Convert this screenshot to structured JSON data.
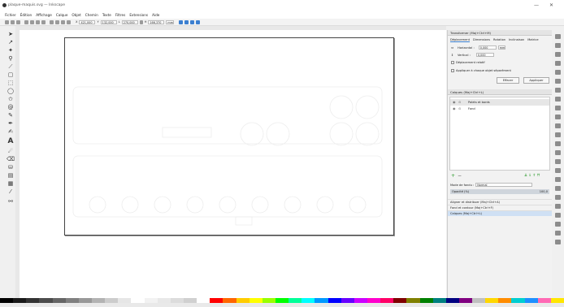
{
  "window": {
    "title": "plaque-maquis.svg — Inkscape",
    "minimize": "—",
    "close": "✕"
  },
  "menu": [
    "Fichier",
    "Édition",
    "Affichage",
    "Calque",
    "Objet",
    "Chemin",
    "Texte",
    "Filtres",
    "Extensions",
    "Aide"
  ],
  "toolbar": {
    "x_label": "X",
    "x_value": "421,000",
    "y_label": "Y",
    "y_value": "132,000",
    "w_label": "L",
    "w_value": "270,000",
    "h_label": "H",
    "h_value": "166,370",
    "unit": "mm"
  },
  "transform_panel": {
    "header": "Transformer (Maj+Ctrl+M)",
    "tabs": [
      "Déplacement",
      "Dimensions",
      "Rotation",
      "Inclinaison",
      "Matrice"
    ],
    "horizontal_label": "Horizontal :",
    "horizontal_value": "0,000",
    "vertical_label": "Vertical :",
    "vertical_value": "0,000",
    "unit": "mm",
    "relative_label": "Déplacement relatif",
    "each_label": "Appliquer à chaque objet séparément",
    "clear_button": "Effacer",
    "apply_button": "Appliquer"
  },
  "layers_panel": {
    "header": "Calques (Maj+Ctrl+L)",
    "layers": [
      {
        "name": "Palets et bords"
      },
      {
        "name": "Fond"
      }
    ],
    "blend_label": "Mode de fondu :",
    "blend_value": "Normal",
    "opacity_label": "Opacité (%)",
    "opacity_value": "100,0"
  },
  "docked": [
    "Aligner et distribuer (Maj+Ctrl+A)",
    "Fond et contour (Maj+Ctrl+F)",
    "Calques (Maj+Ctrl+L)"
  ],
  "palette": [
    "#000000",
    "#1a1a1a",
    "#333333",
    "#4d4d4d",
    "#666666",
    "#808080",
    "#999999",
    "#b3b3b3",
    "#cccccc",
    "#e6e6e6",
    "#ffffff",
    "#f2f2f2",
    "#e8e8e8",
    "#dcdcdc",
    "#d0d0d0",
    "#ffffff",
    "#ff0000",
    "#ff6600",
    "#ffcc00",
    "#ffff00",
    "#99ff00",
    "#00ff00",
    "#00ff99",
    "#00ffff",
    "#0099ff",
    "#0000ff",
    "#6600ff",
    "#cc00ff",
    "#ff00cc",
    "#ff0066",
    "#800000",
    "#808000",
    "#008000",
    "#008080",
    "#000080",
    "#800080",
    "#c0c0c0",
    "#ffd700",
    "#ff8c00",
    "#00ced1",
    "#1e90ff",
    "#ff69b4",
    "#ffe600"
  ]
}
